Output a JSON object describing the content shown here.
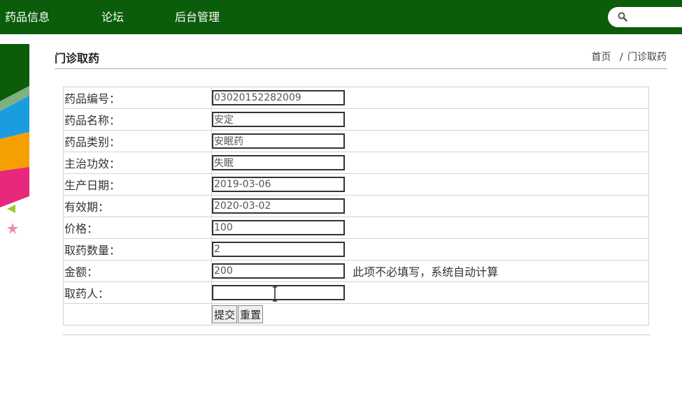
{
  "nav": {
    "items": [
      "药品信息",
      "论坛",
      "后台管理"
    ]
  },
  "search": {
    "icon": "search-icon"
  },
  "page": {
    "title": "门诊取药",
    "breadcrumb": {
      "home": "首页",
      "separator": "/",
      "current": "门诊取药"
    }
  },
  "form": {
    "fields": [
      {
        "label": "药品编号：",
        "value": "03020152282009"
      },
      {
        "label": "药品名称：",
        "value": "安定"
      },
      {
        "label": "药品类别：",
        "value": "安眠药"
      },
      {
        "label": "主治功效：",
        "value": "失眠"
      },
      {
        "label": "生产日期：",
        "value": "2019-03-06"
      },
      {
        "label": "有效期：",
        "value": "2020-03-02"
      },
      {
        "label": "价格：",
        "value": "100"
      },
      {
        "label": "取药数量：",
        "value": "2"
      },
      {
        "label": "金额：",
        "value": "200",
        "hint": "此项不必填写，系统自动计算"
      },
      {
        "label": "取药人：",
        "value": ""
      }
    ],
    "submit_label": "提交",
    "reset_label": "重置"
  },
  "colors": {
    "nav_bg": "#0b5c0b",
    "page_bg": "#ffffff"
  }
}
